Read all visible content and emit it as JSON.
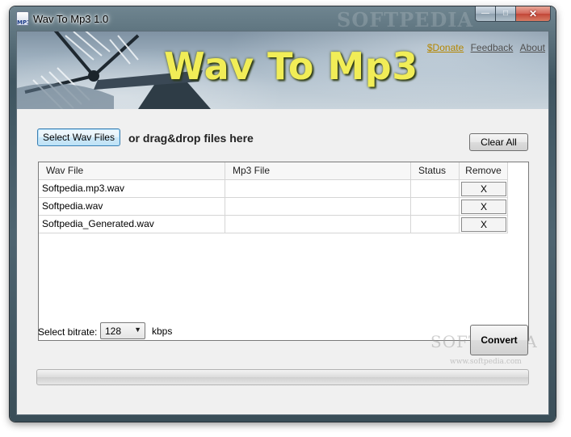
{
  "window": {
    "title": "Wav To Mp3 1.0",
    "title_watermark": "SOFTPEDIA",
    "app_icon_text": "MP3",
    "controls": {
      "minimize": "—",
      "maximize": "□",
      "close": "✕"
    }
  },
  "banner": {
    "title": "Wav To Mp3",
    "links": {
      "donate": "$Donate",
      "feedback": "Feedback",
      "about": "About"
    }
  },
  "toolbar": {
    "select_files_label": "Select Wav Files",
    "drag_drop_text": "or drag&drop files here",
    "clear_all_label": "Clear All"
  },
  "file_list": {
    "columns": [
      "Wav File",
      "Mp3 File",
      "Status",
      "Remove"
    ],
    "rows": [
      {
        "wav": "Softpedia.mp3.wav",
        "mp3": "",
        "status": "",
        "remove": "X"
      },
      {
        "wav": "Softpedia.wav",
        "mp3": "",
        "status": "",
        "remove": "X"
      },
      {
        "wav": "Softpedia_Generated.wav",
        "mp3": "",
        "status": "",
        "remove": "X"
      }
    ]
  },
  "bitrate": {
    "label": "Select bitrate:",
    "selected": "128",
    "unit": "kbps"
  },
  "convert_label": "Convert",
  "watermark": {
    "text": "SOFTPEDIA",
    "url": "www.softpedia.com"
  },
  "progress": {
    "value": 0
  },
  "colors": {
    "banner_title": "#f1ed57",
    "donate_link": "#b38600",
    "progress_fill": "#37b24a"
  }
}
